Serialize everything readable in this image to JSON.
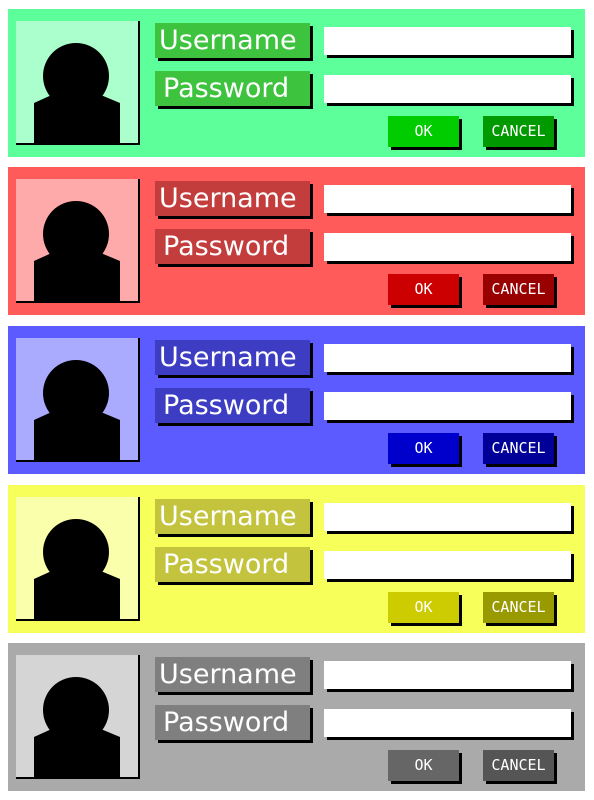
{
  "panels": [
    {
      "theme": "green",
      "colors": {
        "bg": "#5cff99",
        "avatar_bg": "#aaffcc",
        "label_bg": "#3dc33d",
        "ok_bg": "#00cc00",
        "cancel_bg": "#009900"
      },
      "username_label": "Username",
      "password_label": "Password",
      "username_value": "",
      "password_value": "",
      "ok_label": "OK",
      "cancel_label": "CANCEL"
    },
    {
      "theme": "red",
      "colors": {
        "bg": "#ff5b5b",
        "avatar_bg": "#ffaaaa",
        "label_bg": "#c33d3d",
        "ok_bg": "#cc0000",
        "cancel_bg": "#990000"
      },
      "username_label": "Username",
      "password_label": "Password",
      "username_value": "",
      "password_value": "",
      "ok_label": "OK",
      "cancel_label": "CANCEL"
    },
    {
      "theme": "blue",
      "colors": {
        "bg": "#5b5bff",
        "avatar_bg": "#aaaaff",
        "label_bg": "#3d3dc3",
        "ok_bg": "#0000cc",
        "cancel_bg": "#000099"
      },
      "username_label": "Username",
      "password_label": "Password",
      "username_value": "",
      "password_value": "",
      "ok_label": "OK",
      "cancel_label": "CANCEL"
    },
    {
      "theme": "yellow",
      "colors": {
        "bg": "#f7ff5b",
        "avatar_bg": "#f9ffaa",
        "label_bg": "#c3c33d",
        "ok_bg": "#cccc00",
        "cancel_bg": "#999900"
      },
      "username_label": "Username",
      "password_label": "Password",
      "username_value": "",
      "password_value": "",
      "ok_label": "OK",
      "cancel_label": "CANCEL"
    },
    {
      "theme": "gray",
      "colors": {
        "bg": "#aaaaaa",
        "avatar_bg": "#d5d5d5",
        "label_bg": "#7f7f7f",
        "ok_bg": "#666666",
        "cancel_bg": "#555555"
      },
      "username_label": "Username",
      "password_label": "Password",
      "username_value": "",
      "password_value": "",
      "ok_label": "OK",
      "cancel_label": "CANCEL"
    }
  ],
  "icons": {
    "avatar": "user-silhouette-icon"
  }
}
